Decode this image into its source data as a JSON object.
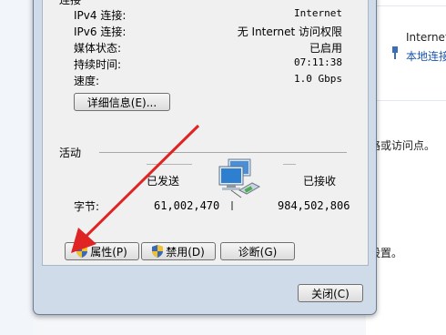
{
  "background": {
    "right_top": "Internet",
    "right_link": "本地连接",
    "right_mid": "路或访问点。",
    "right_bottom": "设置。"
  },
  "connection": {
    "section_label": "连接",
    "rows": [
      {
        "label": "IPv4 连接:",
        "value": "Internet"
      },
      {
        "label": "IPv6 连接:",
        "value": "无 Internet 访问权限"
      },
      {
        "label": "媒体状态:",
        "value": "已启用"
      },
      {
        "label": "持续时间:",
        "value": "07:11:38"
      },
      {
        "label": "速度:",
        "value": "1.0 Gbps"
      }
    ],
    "details_button": "详细信息(E)..."
  },
  "activity": {
    "section_label": "活动",
    "sent_label": "已发送",
    "received_label": "已接收",
    "bytes_label": "字节:",
    "sent_value": "61,002,470",
    "received_value": "984,502,806"
  },
  "buttons": {
    "properties": "属性(P)",
    "disable": "禁用(D)",
    "diagnose": "诊断(G)",
    "close": "关闭(C)"
  },
  "colors": {
    "arrow": "#e02323",
    "dialog_frame": "#cfdbe9",
    "link": "#1a56b0"
  },
  "icons": [
    "shield-icon",
    "network-computers-icon",
    "network-plug-icon",
    "ethernet-icon"
  ]
}
